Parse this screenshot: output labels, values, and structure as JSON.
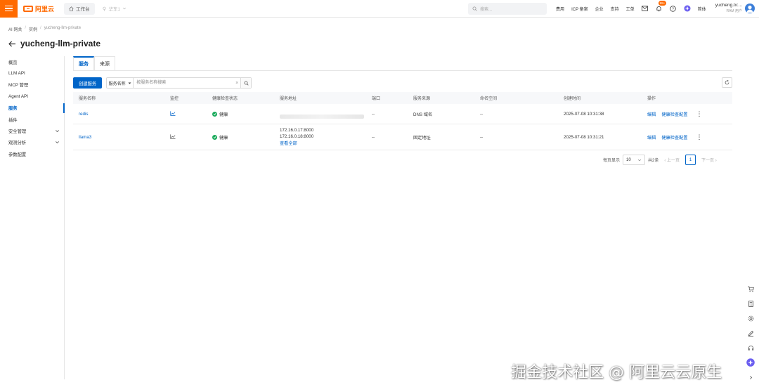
{
  "topbar": {
    "logo_text": "阿里云",
    "workbench_label": "工作台",
    "region_label": "华东1",
    "search_placeholder": "搜索...",
    "links": [
      "费用",
      "ICP 备案",
      "企业",
      "支持",
      "工单"
    ],
    "notification_count": "99+",
    "language_label": "简体",
    "user_name": "yucheng.lx:...",
    "user_role": "RAM 用户"
  },
  "breadcrumb": [
    "AI 网关",
    "实例",
    "yucheng-llm-private"
  ],
  "page_title": "yucheng-llm-private",
  "sidebar": {
    "items": [
      {
        "label": "概览",
        "expandable": false
      },
      {
        "label": "LLM API",
        "expandable": false
      },
      {
        "label": "MCP 管理",
        "expandable": false
      },
      {
        "label": "Agent API",
        "expandable": false
      },
      {
        "label": "服务",
        "expandable": false,
        "active": true
      },
      {
        "label": "插件",
        "expandable": false
      },
      {
        "label": "安全管理",
        "expandable": true
      },
      {
        "label": "观测分析",
        "expandable": true
      },
      {
        "label": "参数配置",
        "expandable": false
      }
    ]
  },
  "tabs": [
    {
      "label": "服务",
      "active": true
    },
    {
      "label": "来源",
      "active": false
    }
  ],
  "toolbar": {
    "create_label": "创建服务",
    "field_select": "服务名称",
    "search_placeholder": "按服务名称搜索"
  },
  "table": {
    "headers": [
      "服务名称",
      "监控",
      "健康检查状态",
      "服务地址",
      "端口",
      "服务来源",
      "命名空间",
      "创建时间",
      "操作"
    ],
    "rows": [
      {
        "name": "redis",
        "health": "健康",
        "address_lines": [],
        "port": "--",
        "source": "DNS 域名",
        "namespace": "--",
        "created": "2025-07-08 10:31:38",
        "op_edit": "编辑",
        "op_health": "健康检查配置"
      },
      {
        "name": "llama3",
        "health": "健康",
        "address_lines": [
          "172.16.0.17:8000",
          "172.16.0.18:8000"
        ],
        "view_all": "查看全部",
        "port": "--",
        "source": "固定地址",
        "namespace": "--",
        "created": "2025-07-08 10:31:21",
        "op_edit": "编辑",
        "op_health": "健康检查配置"
      }
    ]
  },
  "pagination": {
    "per_page_label": "每页显示",
    "page_size": "10",
    "total_label": "共2条",
    "prev_label": "上一页",
    "current_page": "1",
    "next_label": "下一页"
  },
  "watermark": "掘金技术社区 @ 阿里云云原生",
  "colors": {
    "brand": "#ff6a00",
    "primary": "#0064c8",
    "success": "#1bab5c"
  }
}
